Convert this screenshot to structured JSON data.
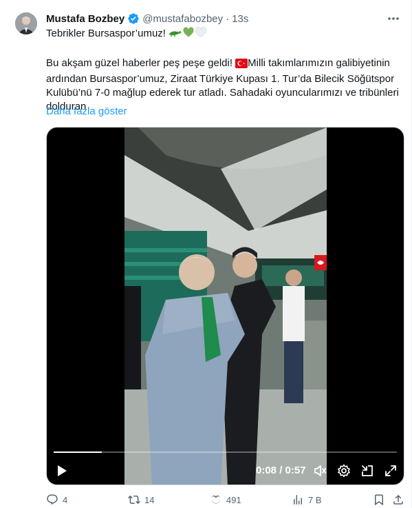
{
  "author": {
    "name": "Mustafa Bozbey",
    "handle": "@mustafabozbey",
    "separator": "·",
    "time": "13s"
  },
  "tweet": {
    "line1": "Tebrikler Bursaspor’umuz! ",
    "para2_a": "Bu akşam güzel haberler peş peşe geldi! ",
    "para2_b": "Milli takımlarımızın galibiyetinin ardından Bursaspor’umuz, Ziraat Türkiye Kupası 1. Tur’da Bilecik Söğütspor Kulübü’nü 7-0 mağlup ederek tur atladı. Sahadaki oyuncularımızı ve tribünleri dolduran",
    "show_more": "Daha fazla göster"
  },
  "video": {
    "progress": 0.14,
    "current_time": "0:08",
    "separator": "/",
    "duration": "0:57"
  },
  "actions": {
    "replies": "4",
    "reposts": "14",
    "likes": "491",
    "views": "7 B"
  },
  "icons": {
    "verified": "verified-badge-icon",
    "more": "more-dots-icon",
    "play": "play-icon",
    "volume": "volume-icon",
    "settings": "settings-gear-icon",
    "exit_fullscreen": "minimize-icon",
    "fullscreen": "fullscreen-icon",
    "reply": "reply-bubble-icon",
    "repost": "repost-arrows-icon",
    "like": "heart-icon",
    "views": "views-bar-chart-icon",
    "bookmark": "bookmark-icon",
    "share": "share-icon"
  },
  "colors": {
    "accent": "#1d9bf0",
    "muted": "#536471",
    "text": "#0f1419",
    "verified": "#1d9bf0"
  }
}
